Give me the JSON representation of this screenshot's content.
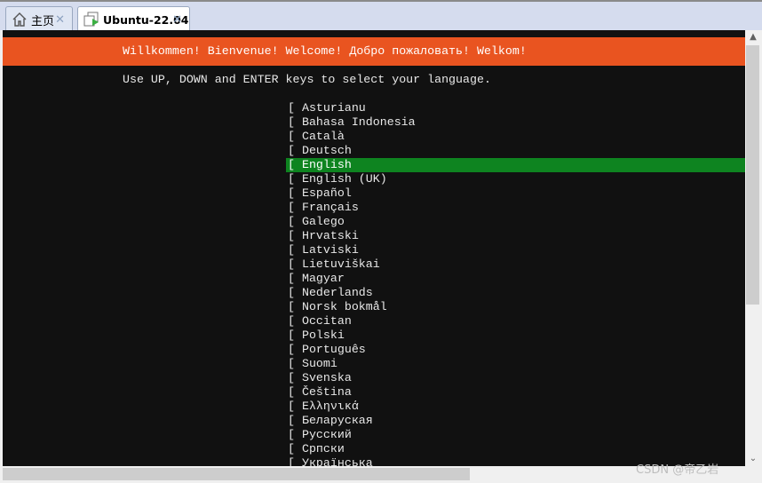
{
  "tabs": [
    {
      "label": "主页",
      "icon": "home-icon"
    },
    {
      "label": "Ubuntu-22.04",
      "icon": "vm-running-icon",
      "active": true
    }
  ],
  "terminal": {
    "banner": "Willkommen! Bienvenue! Welcome! Добро пожаловать! Welkom!",
    "instruction": "Use UP, DOWN and ENTER keys to select your language.",
    "languages": [
      "Asturianu",
      "Bahasa Indonesia",
      "Català",
      "Deutsch",
      "English",
      "English (UK)",
      "Español",
      "Français",
      "Galego",
      "Hrvatski",
      "Latviski",
      "Lietuviškai",
      "Magyar",
      "Nederlands",
      "Norsk bokmål",
      "Occitan",
      "Polski",
      "Português",
      "Suomi",
      "Svenska",
      "Čeština",
      "Ελληνικά",
      "Беларуская",
      "Русский",
      "Српски",
      "Українська"
    ],
    "selected": "English",
    "colors": {
      "banner": "#e95420",
      "selection": "#0e8420",
      "background": "#111111"
    }
  },
  "watermark": "CSDN @帝乙岩"
}
